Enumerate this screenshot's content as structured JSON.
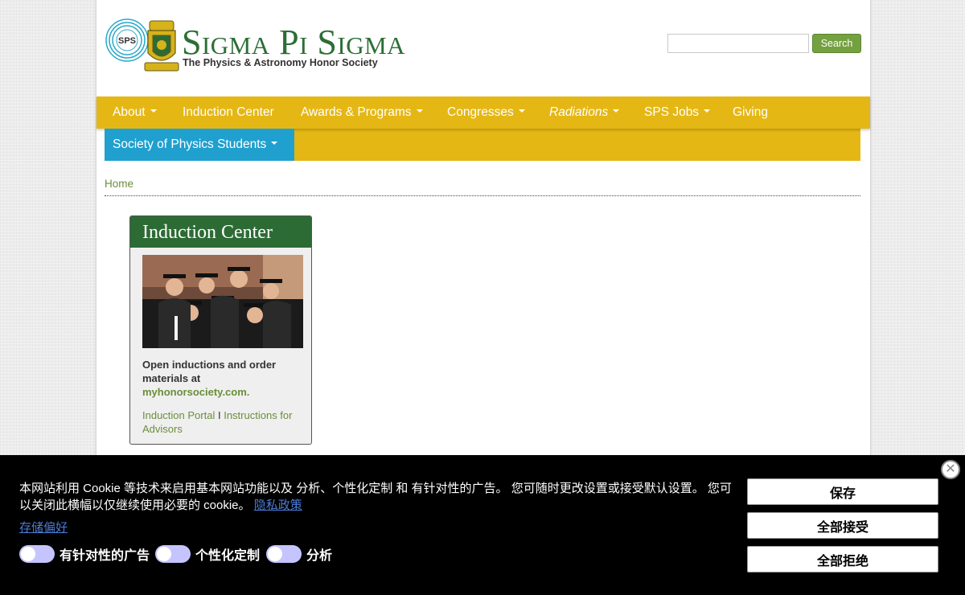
{
  "colors": {
    "brand_green": "#2c6e35",
    "nav_gold": "#e5b714",
    "nav_blue": "#1fa0cf",
    "link_green": "#6b8e3c",
    "search_green": "#73a13f",
    "toggle_lilac": "#c5c4ff"
  },
  "header": {
    "logo_badge": "SPS",
    "title": "Sigma Pi Sigma",
    "tagline": "The Physics & Astronomy Honor Society",
    "search_placeholder": "",
    "search_button": "Search"
  },
  "nav": {
    "items": [
      {
        "label": "About",
        "dropdown": true
      },
      {
        "label": "Induction Center",
        "dropdown": false
      },
      {
        "label": "Awards & Programs",
        "dropdown": true
      },
      {
        "label": "Congresses",
        "dropdown": true
      },
      {
        "label": "Radiations",
        "dropdown": true
      },
      {
        "label": "SPS Jobs",
        "dropdown": true
      },
      {
        "label": "Giving",
        "dropdown": false
      }
    ],
    "sps": {
      "label": "Society of Physics Students",
      "dropdown": true
    }
  },
  "breadcrumb": {
    "home": "Home"
  },
  "induction": {
    "title": "Induction Center",
    "text_main": "Open inductions and order materials at",
    "text_link": "myhonorsociety.com.",
    "portal_link": "Induction Portal",
    "separator": "I",
    "instructions_link": "Instructions for Advisors"
  },
  "cookie": {
    "message": "本网站利用 Cookie 等技术来启用基本网站功能以及 分析、个性化定制 和 有针对性的广告。 您可随时更改设置或接受默认设置。 您可以关闭此横幅以仅继续使用必要的 cookie。",
    "privacy_link": "隐私政策",
    "save_prefs": "存储偏好",
    "toggles": [
      {
        "label": "有针对性的广告",
        "on": false
      },
      {
        "label": "个性化定制",
        "on": false
      },
      {
        "label": "分析",
        "on": false
      }
    ],
    "buttons": {
      "save": "保存",
      "accept_all": "全部接受",
      "reject_all": "全部拒绝"
    },
    "close_icon": "close-icon"
  }
}
